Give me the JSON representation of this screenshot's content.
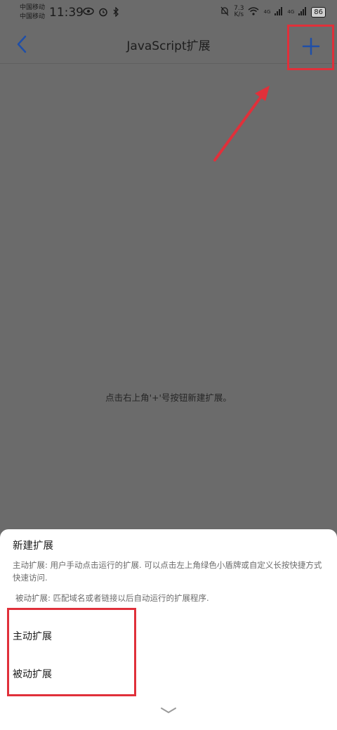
{
  "status_bar": {
    "carrier_1": "中国移动",
    "carrier_2": "中国移动",
    "time": "11:39",
    "net_speed_value": "7.3",
    "net_speed_unit": "K/s",
    "signal_1_label": "4G",
    "signal_2_label": "4G",
    "battery": "86"
  },
  "app_bar": {
    "title": "JavaScript扩展"
  },
  "main": {
    "empty_hint": "点击右上角'+'号按钮新建扩展。"
  },
  "sheet": {
    "title": "新建扩展",
    "active_desc": "主动扩展: 用户手动点击运行的扩展. 可以点击左上角绿色小盾牌或自定义长按快捷方式快速访问.",
    "passive_desc": "被动扩展: 匹配域名或者链接以后自动运行的扩展程序.",
    "options": [
      {
        "label": "主动扩展"
      },
      {
        "label": "被动扩展"
      }
    ]
  },
  "colors": {
    "accent": "#1f4fa8",
    "highlight": "#e0303a",
    "overlay": "#6b6b6b"
  }
}
